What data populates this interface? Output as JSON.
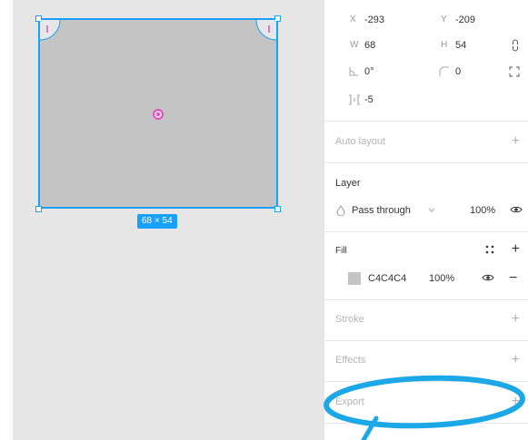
{
  "canvas": {
    "size_badge": "68 × 54"
  },
  "position": {
    "x_label": "X",
    "x_value": "-293",
    "y_label": "Y",
    "y_value": "-209",
    "w_label": "W",
    "w_value": "68",
    "h_label": "H",
    "h_value": "54",
    "rotation_value": "0°",
    "radius_value": "0",
    "spacing_value": "-5"
  },
  "auto_layout": {
    "title": "Auto layout"
  },
  "layer": {
    "title": "Layer",
    "blend_mode": "Pass through",
    "opacity": "100%"
  },
  "fill": {
    "title": "Fill",
    "hex": "C4C4C4",
    "opacity": "100%",
    "color": "#C4C4C4"
  },
  "stroke": {
    "title": "Stroke"
  },
  "effects": {
    "title": "Effects"
  },
  "export": {
    "title": "Export"
  },
  "colors": {
    "accent": "#18A0FB",
    "annotation": "#1CA8E6",
    "radius_handle": "#E64FC0"
  }
}
